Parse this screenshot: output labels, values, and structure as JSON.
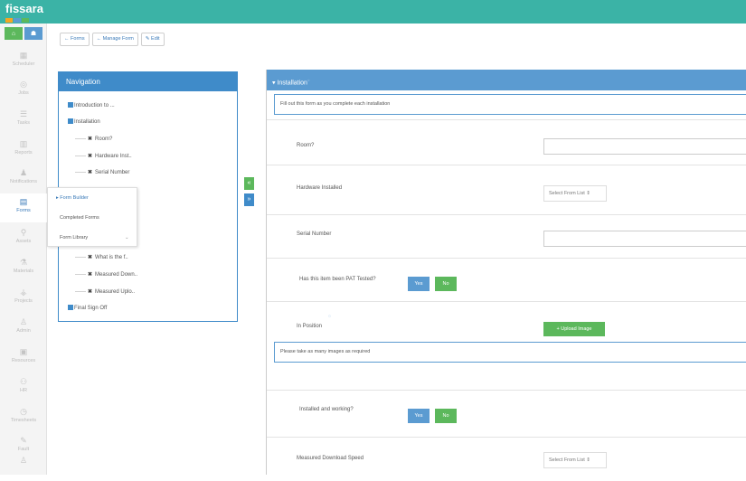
{
  "app": {
    "title": "fissara"
  },
  "colors": {
    "accent": "#3bb3a6",
    "primary": "#3f8bc9",
    "success": "#5cb85c",
    "logo_squares": [
      "#f5a623",
      "#5b9bd1",
      "#5cb85c"
    ]
  },
  "sidebar": {
    "top_icons": [
      "home-icon",
      "users-icon"
    ],
    "items": [
      {
        "label": "Scheduler",
        "icon": "calendar-icon"
      },
      {
        "label": "Jobs",
        "icon": "compass-icon"
      },
      {
        "label": "Tasks",
        "icon": "list-icon"
      },
      {
        "label": "Reports",
        "icon": "bar-chart-icon"
      },
      {
        "label": "Notifications",
        "icon": "bell-icon"
      },
      {
        "label": "Forms",
        "icon": "file-icon"
      },
      {
        "label": "Assets",
        "icon": "tag-icon"
      },
      {
        "label": "Materials",
        "icon": "flask-icon"
      },
      {
        "label": "Projects",
        "icon": "sitemap-icon"
      },
      {
        "label": "Admin",
        "icon": "user-icon"
      },
      {
        "label": "Resources",
        "icon": "building-icon"
      },
      {
        "label": "HR",
        "icon": "people-icon"
      },
      {
        "label": "Timesheets",
        "icon": "clock-icon"
      },
      {
        "label": "Fault",
        "icon": "wrench-icon"
      },
      {
        "label": "",
        "icon": "user-icon"
      }
    ]
  },
  "toolbar": {
    "forms_label": "Forms",
    "manage_label": "Manage Form",
    "edit_label": "Edit"
  },
  "nav": {
    "title": "Navigation",
    "root1": "Introduction to ...",
    "root2": "Installation",
    "children": [
      "Room?",
      "Hardware Inst..",
      "Serial Number",
      "What is the f..",
      "Measured Down..",
      "Measured Uplo.."
    ],
    "root3": "Final Sign Off"
  },
  "popup": {
    "items": [
      "Form Builder",
      "Completed Forms",
      "Form Library"
    ]
  },
  "form": {
    "section_title": "Installation",
    "note1": "Fill out this form as you complete each installation",
    "note2": "Please take as many images as required",
    "select_placeholder": "Select From List",
    "fields": {
      "room": "Room?",
      "hardware": "Hardware Installed",
      "serial": "Serial Number",
      "pat": "Has this item been PAT Tested?",
      "position": "In Position",
      "working": "Installed and working?",
      "download": "Measured Download Speed"
    },
    "yes": "Yes",
    "no": "No",
    "upload": "Upload Image"
  }
}
